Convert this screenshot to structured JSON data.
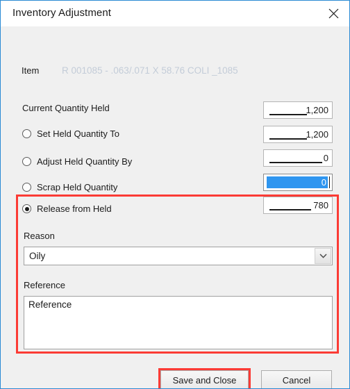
{
  "window": {
    "title": "Inventory Adjustment",
    "close_icon": "close-icon",
    "accent_border": "#2a8ad4",
    "body_bg": "#f0f0f0"
  },
  "item": {
    "label": "Item",
    "value": "R 001085 -  .063/.071 X 58.76 COLI   _1085",
    "value_color": "#c3ccd8"
  },
  "rows": [
    {
      "label": "Current Quantity Held",
      "has_radio": false,
      "selected": false,
      "field_value": "1,200",
      "field_state": "normal"
    },
    {
      "label": "Set Held Quantity To",
      "has_radio": true,
      "selected": false,
      "field_value": "1,200",
      "field_state": "normal"
    },
    {
      "label": "Adjust Held Quantity By",
      "has_radio": true,
      "selected": false,
      "field_value": "0",
      "field_state": "normal"
    },
    {
      "label": "Scrap Held Quantity",
      "has_radio": true,
      "selected": false,
      "field_value": "0",
      "field_state": "selected"
    },
    {
      "label": "Release from Held",
      "has_radio": true,
      "selected": true,
      "field_value": "780",
      "field_state": "normal"
    }
  ],
  "reason": {
    "label": "Reason",
    "selected_option": "Oily",
    "dropdown_icon": "chevron-down-icon"
  },
  "reference": {
    "label": "Reference",
    "value": "Reference"
  },
  "buttons": {
    "save_label": "Save and Close",
    "cancel_label": "Cancel"
  },
  "annotations": {
    "highlight_color": "#fb3b35",
    "group_highlight": "release-from-held-group",
    "button_highlight": "save-and-close-button"
  },
  "colors": {
    "selection_blue": "#2f96f0",
    "accent": "#2a8ad4",
    "text": "#1b1b1b"
  }
}
